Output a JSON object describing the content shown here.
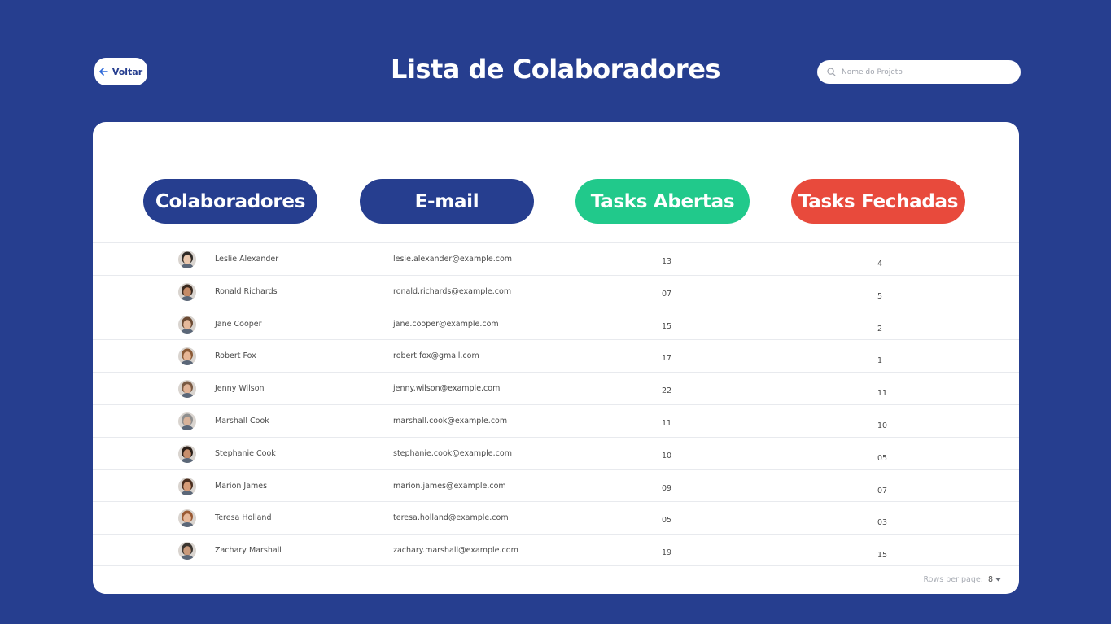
{
  "header": {
    "back_label": "Voltar",
    "title": "Lista de Colaboradores",
    "search_placeholder": "Nome do Projeto"
  },
  "columns": {
    "collaborators": "Colaboradores",
    "email": "E-mail",
    "open_tasks": "Tasks Abertas",
    "closed_tasks": "Tasks Fechadas"
  },
  "colors": {
    "background": "#263e8f",
    "primary": "#263e8f",
    "open_green": "#21c98b",
    "closed_red": "#e84a3c"
  },
  "rows": [
    {
      "name": "Leslie Alexander",
      "email": "lesie.alexander@example.com",
      "open": "13",
      "closed": "4",
      "skin": "#e9c7ad",
      "hair": "#2f2a26"
    },
    {
      "name": "Ronald Richards",
      "email": "ronald.richards@example.com",
      "open": "07",
      "closed": "5",
      "skin": "#c58b67",
      "hair": "#3a2a20"
    },
    {
      "name": "Jane Cooper",
      "email": "jane.cooper@example.com",
      "open": "15",
      "closed": "2",
      "skin": "#e5b99b",
      "hair": "#6b4a33"
    },
    {
      "name": "Robert Fox",
      "email": "robert.fox@gmail.com",
      "open": "17",
      "closed": "1",
      "skin": "#e7b695",
      "hair": "#8a5a36"
    },
    {
      "name": "Jenny Wilson",
      "email": "jenny.wilson@example.com",
      "open": "22",
      "closed": "11",
      "skin": "#e1b396",
      "hair": "#7a5a43"
    },
    {
      "name": "Marshall Cook",
      "email": "marshall.cook@example.com",
      "open": "11",
      "closed": "10",
      "skin": "#d9b39a",
      "hair": "#8f8f8f"
    },
    {
      "name": "Stephanie Cook",
      "email": "stephanie.cook@example.com",
      "open": "10",
      "closed": "05",
      "skin": "#c88f6d",
      "hair": "#2b1f18"
    },
    {
      "name": "Marion James",
      "email": "marion.james@example.com",
      "open": "09",
      "closed": "07",
      "skin": "#d69c78",
      "hair": "#4a2e1f"
    },
    {
      "name": "Teresa Holland",
      "email": "teresa.holland@example.com",
      "open": "05",
      "closed": "03",
      "skin": "#e6b89a",
      "hair": "#9a5a34"
    },
    {
      "name": "Zachary Marshall",
      "email": "zachary.marshall@example.com",
      "open": "19",
      "closed": "15",
      "skin": "#c99a7c",
      "hair": "#3b3530"
    }
  ],
  "pagination": {
    "rows_per_page_label": "Rows per page:",
    "rows_per_page_value": "8"
  }
}
